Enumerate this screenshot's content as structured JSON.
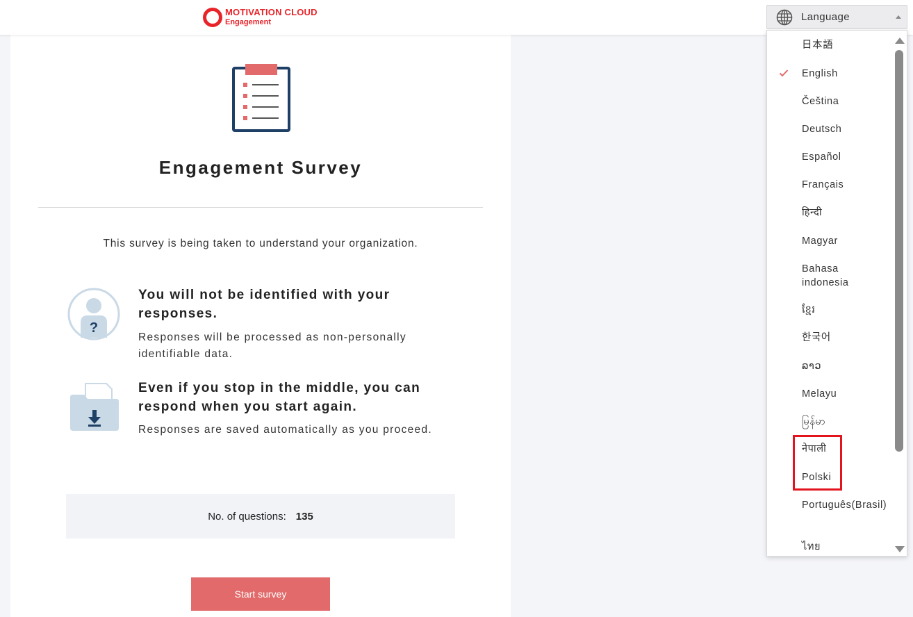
{
  "header": {
    "logo_line1": "MOTIVATION CLOUD",
    "logo_line2": "Engagement",
    "brand_color": "#e8242a",
    "language_label": "Language"
  },
  "language_menu": {
    "selected": "English",
    "items": [
      {
        "label": "日本語"
      },
      {
        "label": "English",
        "checked": true
      },
      {
        "label": "Čeština"
      },
      {
        "label": "Deutsch"
      },
      {
        "label": "Español"
      },
      {
        "label": "Français"
      },
      {
        "label": "हिन्दी"
      },
      {
        "label": "Magyar"
      },
      {
        "label": "Bahasa indonesia"
      },
      {
        "label": "ខ្មែរ"
      },
      {
        "label": "한국어"
      },
      {
        "label": "ລາວ"
      },
      {
        "label": "Melayu"
      },
      {
        "label": "မြန်မာ"
      },
      {
        "label": "नेपाली"
      },
      {
        "label": "Polski"
      },
      {
        "label": "Português(Brasil)"
      },
      {
        "label": "ไทย"
      }
    ],
    "highlight_color": "#e3141d"
  },
  "survey": {
    "title": "Engagement Survey",
    "intro": "This survey is being taken to understand your organization.",
    "features": [
      {
        "icon": "anonymous-user-icon",
        "heading": "You will not be identified with your responses.",
        "body": "Responses will be processed as non-personally identifiable data."
      },
      {
        "icon": "folder-download-icon",
        "heading": "Even if you stop in the middle, you can respond when you start again.",
        "body": "Responses are saved automatically as you proceed."
      }
    ],
    "questions_label": "No. of questions:",
    "questions_count": "135",
    "start_label": "Start survey",
    "accent_color": "#e26a6a"
  }
}
